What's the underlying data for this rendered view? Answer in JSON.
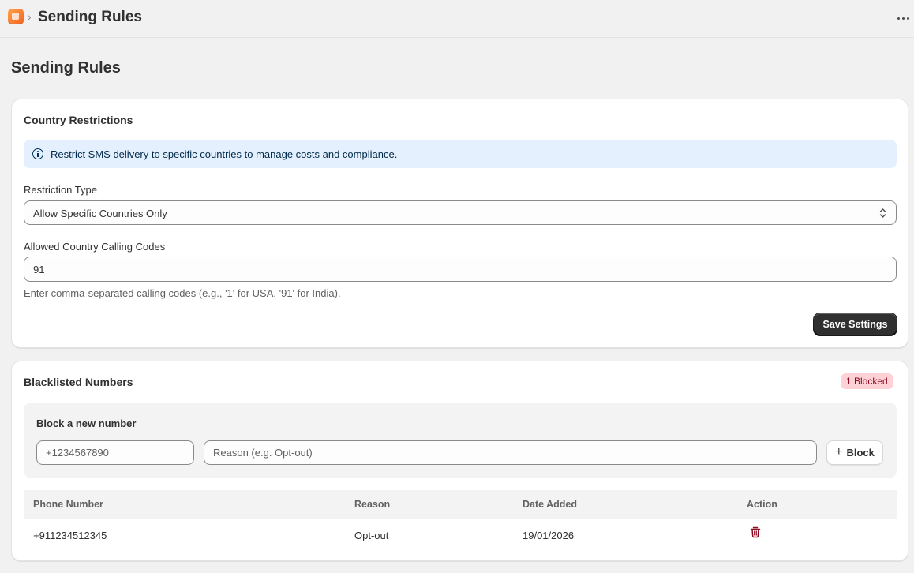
{
  "header": {
    "breadcrumb_separator": "›",
    "title": "Sending Rules",
    "app_icon": "app-logo-icon",
    "more_icon": "more-horizontal-icon"
  },
  "page": {
    "title": "Sending Rules"
  },
  "country_restrictions": {
    "title": "Country Restrictions",
    "banner": {
      "icon": "info-icon",
      "text": "Restrict SMS delivery to specific countries to manage costs and compliance.",
      "background_color": "#e4f0fd"
    },
    "restriction_type": {
      "label": "Restriction Type",
      "selected": "Allow Specific Countries Only"
    },
    "calling_codes": {
      "label": "Allowed Country Calling Codes",
      "value": "91",
      "help": "Enter comma-separated calling codes (e.g., '1' for USA, '91' for India)."
    },
    "save_label": "Save Settings"
  },
  "blacklist": {
    "title": "Blacklisted Numbers",
    "badge": "1 Blocked",
    "badge_color": "#fed1d7",
    "form": {
      "title": "Block a new number",
      "phone_placeholder": "+1234567890",
      "reason_placeholder": "Reason (e.g. Opt-out)",
      "block_label": "Block",
      "block_icon": "plus-icon"
    },
    "table": {
      "columns": [
        "Phone Number",
        "Reason",
        "Date Added",
        "Action"
      ],
      "rows": [
        {
          "phone": "+911234512345",
          "reason": "Opt-out",
          "date": "19/01/2026",
          "action_icon": "trash-icon"
        }
      ]
    },
    "delete_color": "#8e0b21"
  }
}
